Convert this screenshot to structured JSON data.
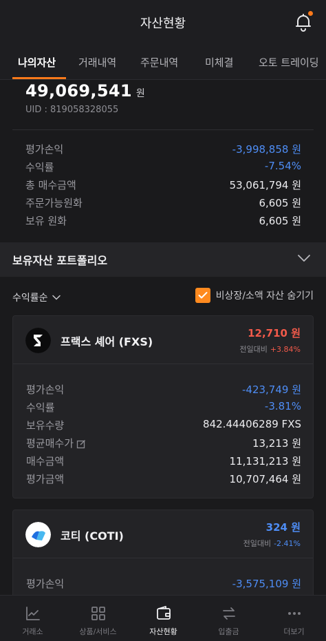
{
  "header": {
    "title": "자산현황"
  },
  "tabs": [
    {
      "label": "나의자산",
      "active": true
    },
    {
      "label": "거래내역",
      "active": false
    },
    {
      "label": "주문내역",
      "active": false
    },
    {
      "label": "미체결",
      "active": false
    },
    {
      "label": "오토 트레이딩",
      "active": false
    }
  ],
  "summary": {
    "total_amount": "49,069,541",
    "total_unit": "원",
    "uid": "UID : 819058328055",
    "rows": [
      {
        "label": "평가손익",
        "value": "-3,998,858 원"
      },
      {
        "label": "수익률",
        "value": "-7.54%"
      },
      {
        "label": "총 매수금액",
        "value": "53,061,794 원"
      },
      {
        "label": "주문가능원화",
        "value": "6,605 원"
      },
      {
        "label": "보유 원화",
        "value": "6,605 원"
      }
    ]
  },
  "portfolio": {
    "title": "보유자산 포트폴리오",
    "sort_label": "수익률순",
    "hide_small_label": "비상장/소액 자산 숨기기",
    "hide_small_checked": true
  },
  "cards": [
    {
      "name": "프랙스 셰어 (FXS)",
      "price": "12,710 원",
      "change_label": "전일대비",
      "change_value": "+3.84%",
      "rows": [
        {
          "label": "평가손익",
          "value": "-423,749 원"
        },
        {
          "label": "수익률",
          "value": "-3.81%"
        },
        {
          "label": "보유수량",
          "value": "842.44406289 FXS"
        },
        {
          "label": "평균매수가",
          "value": "13,213 원"
        },
        {
          "label": "매수금액",
          "value": "11,131,213 원"
        },
        {
          "label": "평가금액",
          "value": "10,707,464 원"
        }
      ]
    },
    {
      "name": "코티 (COTI)",
      "price": "324 원",
      "change_label": "전일대비",
      "change_value": "-2.41%",
      "rows": [
        {
          "label": "평가손익",
          "value": "-3,575,109 원"
        }
      ]
    }
  ],
  "bottom_nav": [
    {
      "label": "거래소",
      "icon": "chart-line-icon",
      "active": false
    },
    {
      "label": "상품/서비스",
      "icon": "grid-icon",
      "active": false
    },
    {
      "label": "자산현황",
      "icon": "wallet-icon",
      "active": true
    },
    {
      "label": "입출금",
      "icon": "transfer-icon",
      "active": false
    },
    {
      "label": "더보기",
      "icon": "more-dots-icon",
      "active": false
    }
  ],
  "colors": {
    "accent": "#ff7a1a",
    "negative_blue": "#4e8df5",
    "positive_red": "#f25a4a",
    "background": "#1a1a1c"
  }
}
